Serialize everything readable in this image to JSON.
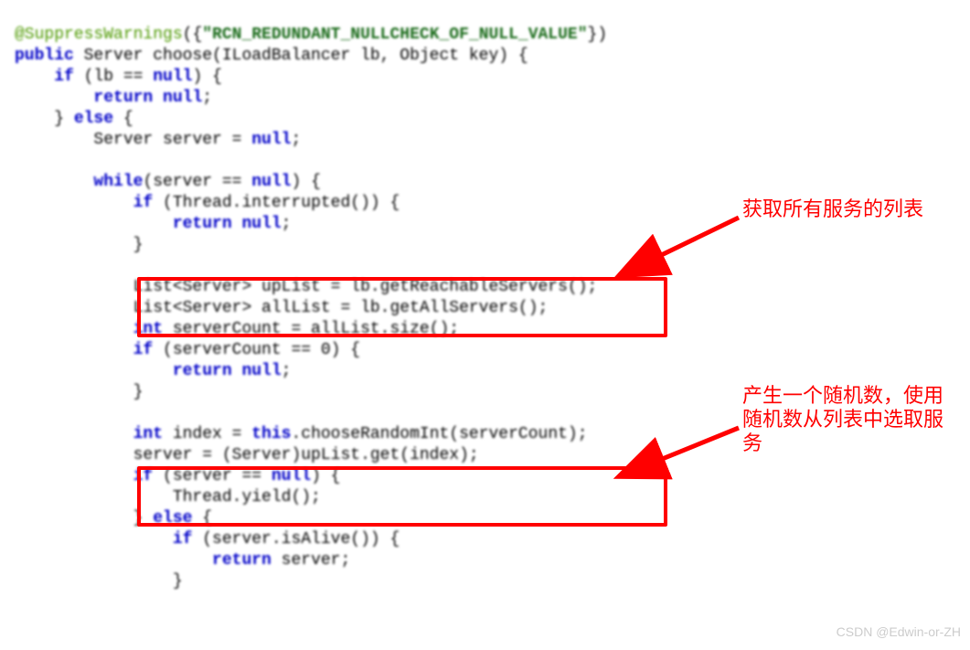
{
  "code": {
    "anno1": "@SuppressWarnings",
    "annoBrace": "({",
    "annoStr": "\"RCN_REDUNDANT_NULLCHECK_OF_NULL_VALUE\"",
    "annoClose": "})",
    "kw_public": "public",
    "kw_if": "if",
    "kw_else": "else",
    "kw_return": "return",
    "kw_null": "null",
    "kw_while": "while",
    "kw_int": "int",
    "kw_this": "this",
    "sig": " Server choose(ILoadBalancer lb, Object key) {",
    "l3": " (lb == ",
    "l3b": ") {",
    "l4": " ",
    "l4b": ";",
    "l5": "} ",
    "l5b": " {",
    "l6": "Server server = ",
    "l6b": ";",
    "l8a": "(server == ",
    "l8b": ") {",
    "l9a": " (Thread.interrupted()) {",
    "l10": " ",
    "l10b": ";",
    "l11": "}",
    "l13": "List<Server> upList = lb.getReachableServers();",
    "l14": "List<Server> allList = lb.getAllServers();",
    "l15": " serverCount = allList.size();",
    "l16a": " (serverCount == 0) {",
    "l17": " ",
    "l17b": ";",
    "l18": "}",
    "l20a": " index = ",
    "l20b": ".chooseRandomInt(serverCount);",
    "l21": "server = (Server)upList.get(index);",
    "l22a": " (server == ",
    "l22b": ") {",
    "l23": "Thread.yield();",
    "l24": "} ",
    "l24b": " {",
    "l25a": " (server.isAlive()) {",
    "l26": " server;",
    "l27": "}"
  },
  "notes": {
    "n1": "获取所有服务的列表",
    "n2a": "产生一个随机数，使用",
    "n2b": "随机数从列表中选取服",
    "n2c": "务"
  },
  "watermark": "CSDN @Edwin-or-ZH"
}
